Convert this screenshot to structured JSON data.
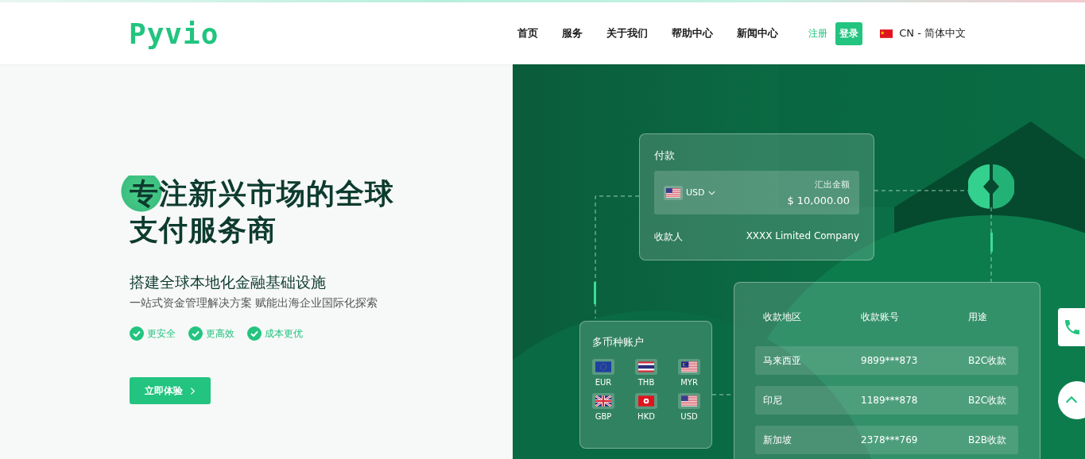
{
  "header": {
    "logo": "Pyvio",
    "nav": [
      {
        "label": "首页"
      },
      {
        "label": "服务"
      },
      {
        "label": "关于我们"
      },
      {
        "label": "帮助中心"
      },
      {
        "label": "新闻中心"
      }
    ],
    "register": "注册",
    "login": "登录",
    "language": {
      "kind": "cn",
      "label": "CN - 简体中文"
    }
  },
  "hero": {
    "title_lines": [
      "专注新兴市场的全球",
      "支付服务商"
    ],
    "subtitle": "搭建全球本地化金融基础设施",
    "description": "一站式资金管理解决方案 赋能出海企业国际化探索",
    "features": [
      "更安全",
      "更高效",
      "成本更优"
    ],
    "cta": "立即体验"
  },
  "illustration": {
    "payment_card": {
      "title": "付款",
      "currency": {
        "kind": "us",
        "code": "USD"
      },
      "amount_label": "汇出金额",
      "amount": "$ 10,000.00",
      "payee_label": "收款人",
      "payee": "XXXX  Limited Company"
    },
    "accounts_card": {
      "title": "多币种账户",
      "currencies": [
        {
          "kind": "eu",
          "code": "EUR"
        },
        {
          "kind": "th",
          "code": "THB"
        },
        {
          "kind": "my",
          "code": "MYR"
        },
        {
          "kind": "gb",
          "code": "GBP"
        },
        {
          "kind": "hk",
          "code": "HKD"
        },
        {
          "kind": "us",
          "code": "USD"
        }
      ]
    },
    "payee_table": {
      "columns": [
        "收款地区",
        "收款账号",
        "用途"
      ],
      "rows": [
        [
          "马来西亚",
          "9899***873",
          "B2C收款"
        ],
        [
          "印尼",
          "1189***878",
          "B2C收款"
        ],
        [
          "新加坡",
          "2378***769",
          "B2B收款"
        ]
      ]
    }
  }
}
